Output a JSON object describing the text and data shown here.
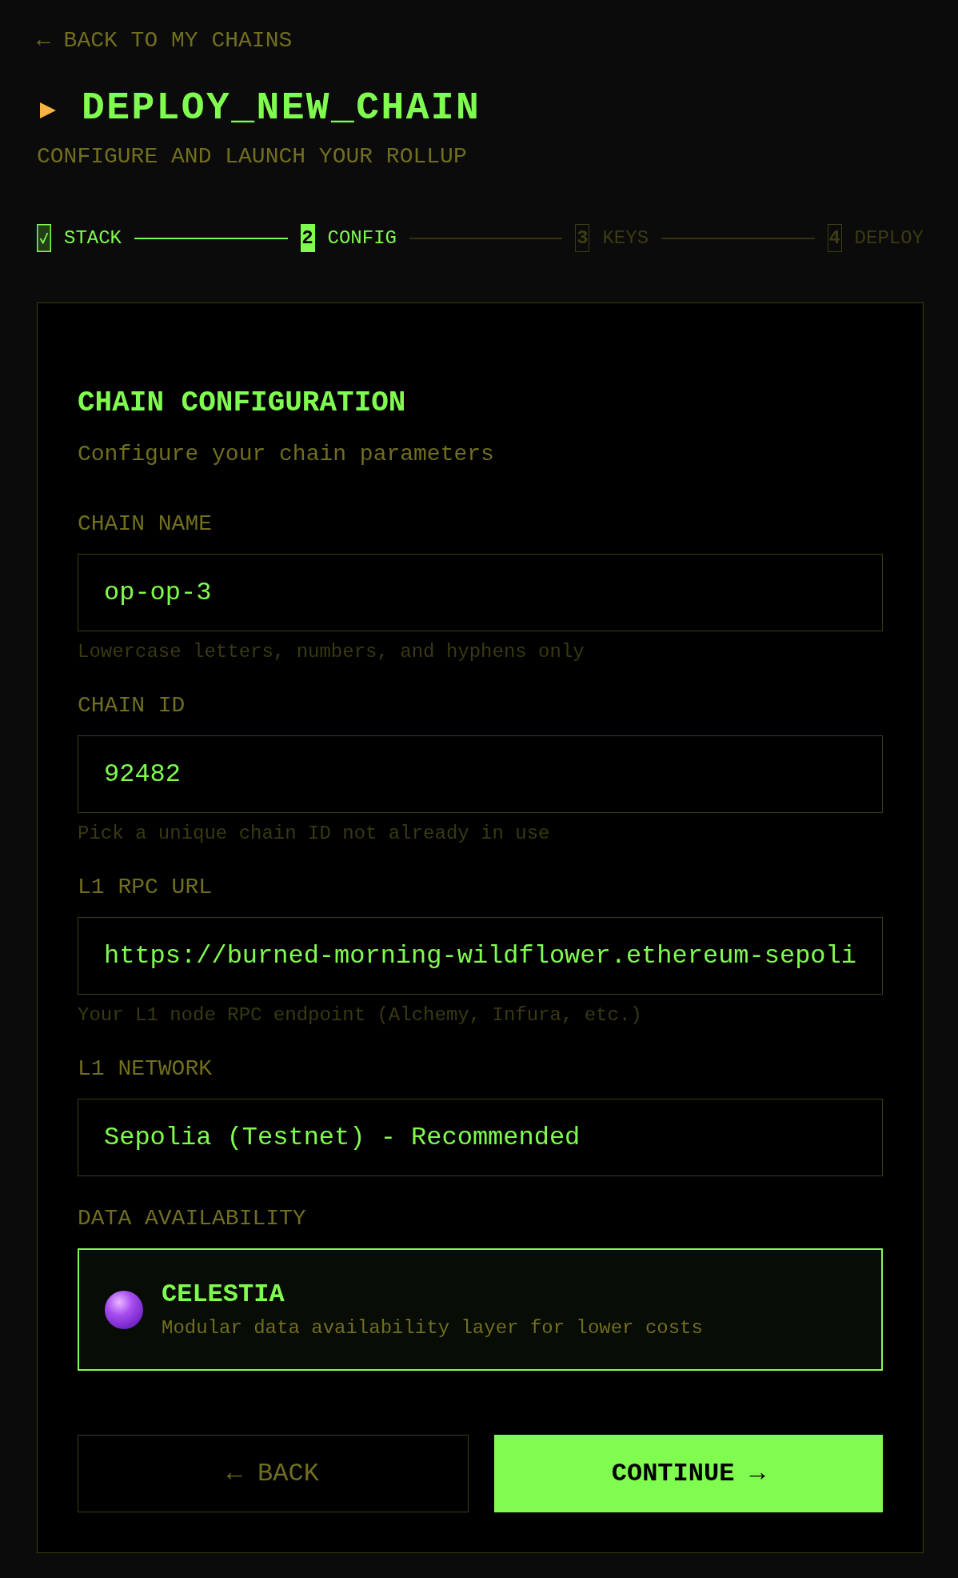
{
  "back_link": "← BACK TO MY CHAINS",
  "header": {
    "title": "DEPLOY_NEW_CHAIN",
    "subtitle": "CONFIGURE AND LAUNCH YOUR ROLLUP"
  },
  "steps": [
    {
      "label": "STACK",
      "completed": true,
      "selected": false
    },
    {
      "number": "2",
      "label": "CONFIG",
      "completed": false,
      "selected": true
    },
    {
      "number": "3",
      "label": "KEYS",
      "completed": false,
      "selected": false
    },
    {
      "number": "4",
      "label": "DEPLOY",
      "completed": false,
      "selected": false
    }
  ],
  "card": {
    "title": "CHAIN CONFIGURATION",
    "subtitle": "Configure your chain parameters",
    "fields": [
      {
        "label": "CHAIN NAME",
        "value": "op-op-3",
        "hint": "Lowercase letters, numbers, and hyphens only"
      },
      {
        "label": "CHAIN ID",
        "value": "92482",
        "hint": "Pick a unique chain ID not already in use"
      },
      {
        "label": "L1 RPC URL",
        "value": "https://burned-morning-wildflower.ethereum-sepoli",
        "hint": "Your L1 node RPC endpoint (Alchemy, Infura, etc.)"
      },
      {
        "label": "L1 NETWORK",
        "value": "Sepolia (Testnet) - Recommended"
      }
    ],
    "data_availability": {
      "label": "DATA AVAILABILITY",
      "options": [
        {
          "name": "CELESTIA",
          "description": "Modular data availability layer for lower costs",
          "selected": true
        }
      ]
    },
    "buttons": [
      {
        "kind": "secondary",
        "label": "← BACK"
      },
      {
        "kind": "primary",
        "label": "CONTINUE →"
      }
    ]
  }
}
